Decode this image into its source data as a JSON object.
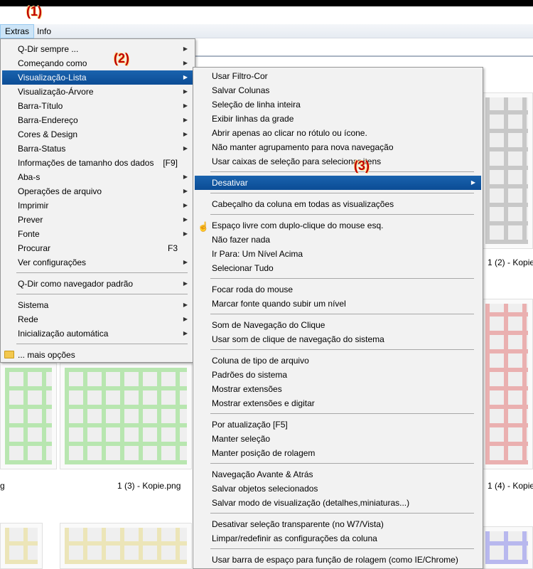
{
  "annotations": {
    "a1": "(1)",
    "a2": "(2)",
    "a3": "(3)"
  },
  "menubar": {
    "extras": "Extras",
    "info": "Info"
  },
  "captions": {
    "c1": "1 (2) - Kopie",
    "c2": "1 (3) - Kopie.png",
    "c3": "1 (4) - Kopie",
    "c4": "g"
  },
  "main_menu": {
    "items": [
      "Q-Dir sempre ...",
      "Começando como",
      "Visualização-Lista",
      "Visualização-Árvore",
      "Barra-Título",
      "Barra-Endereço",
      "Cores & Design",
      "Barra-Status",
      "Informações de tamanho dos dados",
      "Aba-s",
      "Operações de arquivo",
      "Imprimir",
      "Prever",
      "Fonte",
      "Procurar",
      "Ver configurações",
      "Q-Dir como navegador padrão",
      "Sistema",
      "Rede",
      "Inicialização automática",
      "... mais opções"
    ],
    "shortcuts": {
      "info_size": "[F9]",
      "search": "F3"
    }
  },
  "sub_menu": {
    "items": [
      "Usar Filtro-Cor",
      "Salvar Colunas",
      "Seleção de linha inteira",
      "Exibir linhas da grade",
      "Abrir apenas ao clicar no rótulo ou ícone.",
      "Não manter agrupamento para nova navegação",
      "Usar caixas de seleção para selecionar itens",
      "Desativar",
      "Cabeçalho da coluna em todas as visualizações",
      "Espaço livre com duplo-clique do mouse esq.",
      "Não fazer nada",
      "Ir Para: Um Nível Acima",
      "Selecionar Tudo",
      "Focar roda do mouse",
      "Marcar fonte quando subir um nível",
      "Som de Navegação do Clique",
      "Usar som de clique de navegação do sistema",
      "Coluna de tipo de arquivo",
      "Padrões do sistema",
      "Mostrar extensões",
      "Mostrar extensões e digitar",
      "Por atualização [F5]",
      "Manter seleção",
      "Manter posição de rolagem",
      "Navegação Avante & Atrás",
      "Salvar objetos selecionados",
      "Salvar modo de visualização (detalhes,miniaturas...)",
      "Desativar seleção transparente (no W7/Vista)",
      "Limpar/redefinir as configurações da coluna",
      "Usar barra de espaço para função de rolagem (como IE/Chrome)"
    ]
  },
  "colors": {
    "highlight": "#0b4c95",
    "annotation": "#c00000",
    "thumb_gray": "#c8c8c8",
    "thumb_green": "#b8e6b0",
    "thumb_red": "#eab0b0",
    "thumb_yellow": "#ece5b8",
    "thumb_blue": "#b8b8ee"
  }
}
